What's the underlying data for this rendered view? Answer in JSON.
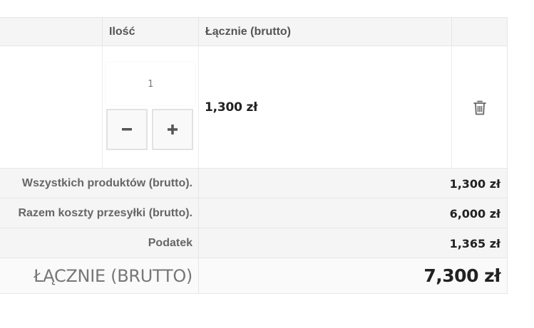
{
  "table": {
    "headers": {
      "product": "",
      "quantity": "Ilość",
      "total": "Łącznie (brutto)",
      "actions": ""
    },
    "item": {
      "quantity": "1",
      "line_total": "1,300 zł",
      "minus_icon": "minus-icon",
      "plus_icon": "plus-icon",
      "delete_icon": "trash-icon"
    }
  },
  "summary": [
    {
      "label": "Wszystkich produktów (brutto).",
      "value": "1,300 zł"
    },
    {
      "label": "Razem koszty przesyłki (brutto).",
      "value": "6,000 zł"
    },
    {
      "label": "Podatek",
      "value": "1,365 zł"
    }
  ],
  "grand_total": {
    "label": "ŁĄCZNIE (BRUTTO)",
    "value": "7,300 zł"
  },
  "colors": {
    "header_bg": "#f5f5f5",
    "border": "#e6e6e6",
    "text_dark": "#222222",
    "text_muted": "#666666"
  }
}
